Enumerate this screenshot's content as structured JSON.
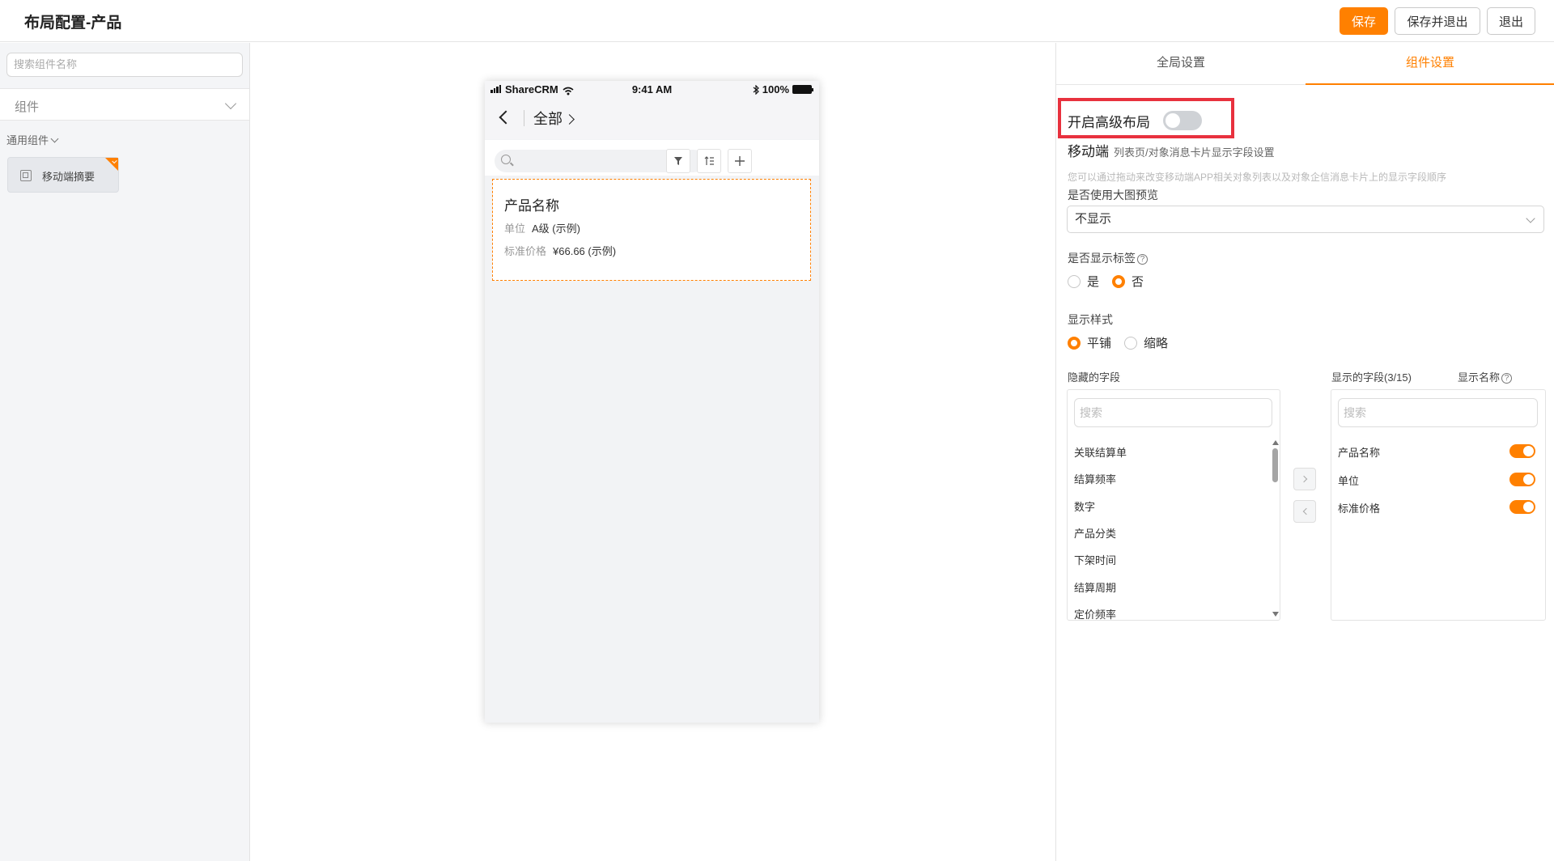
{
  "header": {
    "title": "布局配置-产品",
    "save_label": "保存",
    "save_exit_label": "保存并退出",
    "exit_label": "退出"
  },
  "left_panel": {
    "search_placeholder": "搜索组件名称",
    "group_label": "组件",
    "subgroup_label": "通用组件",
    "component_label": "移动端摘要"
  },
  "phone": {
    "carrier": "ShareCRM",
    "time": "9:41 AM",
    "battery": "100%",
    "nav_title": "全部",
    "card": {
      "product_name": "产品名称",
      "rows": [
        {
          "key": "单位",
          "value": "A级 (示例)"
        },
        {
          "key": "标准价格",
          "value": "¥66.66 (示例)"
        }
      ]
    }
  },
  "right_panel": {
    "tabs": [
      "全局设置",
      "组件设置"
    ],
    "active_tab": "组件设置",
    "advanced_layout_label": "开启高级布局",
    "section_title": "移动端",
    "section_subtitle": "列表页/对象消息卡片显示字段设置",
    "hint": "您可以通过拖动来改变移动端APP相关对象列表以及对象企信消息卡片上的显示字段顺序",
    "large_preview_label": "是否使用大图预览",
    "large_preview_value": "不显示",
    "show_tags_label": "是否显示标签",
    "show_tags_options": [
      "是",
      "否"
    ],
    "show_tags_selected": "否",
    "display_style_label": "显示样式",
    "display_style_options": [
      "平铺",
      "缩略"
    ],
    "display_style_selected": "平铺",
    "hidden_fields_label": "隐藏的字段",
    "shown_fields_label": "显示的字段(3/15)",
    "display_name_label": "显示名称",
    "search_placeholder": "搜索",
    "hidden_fields": [
      "关联结算单",
      "结算频率",
      "数字",
      "产品分类",
      "下架时间",
      "结算周期",
      "定价频率"
    ],
    "shown_fields": [
      "产品名称",
      "单位",
      "标准价格"
    ]
  },
  "colors": {
    "accent": "#ff8000",
    "highlight": "#e8313e"
  }
}
